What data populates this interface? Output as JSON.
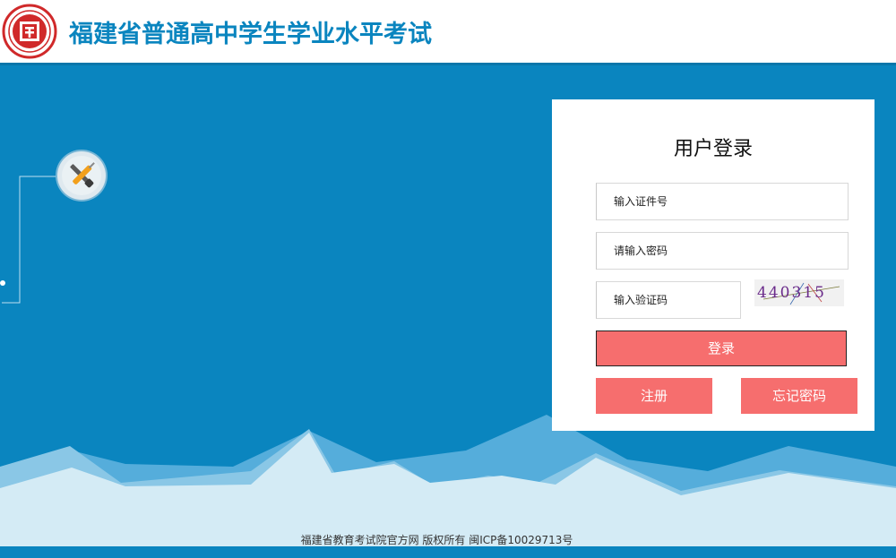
{
  "header": {
    "logo_icon": "exam-authority-seal-logo",
    "title": "福建省普通高中学生学业水平考试"
  },
  "decoration": {
    "tool_icon": "wrench-screwdriver-icon"
  },
  "login": {
    "title": "用户登录",
    "id_placeholder": "输入证件号",
    "password_placeholder": "请输入密码",
    "captcha_placeholder": "输入验证码",
    "captcha_text": "440315",
    "login_button": "登录",
    "register_button": "注册",
    "forgot_button": "忘记密码"
  },
  "footer": {
    "copyright": "福建省教育考试院官方网 版权所有 闽ICP备10029713号"
  },
  "colors": {
    "brand_blue": "#0a85bf",
    "button_red": "#f66e6e"
  }
}
